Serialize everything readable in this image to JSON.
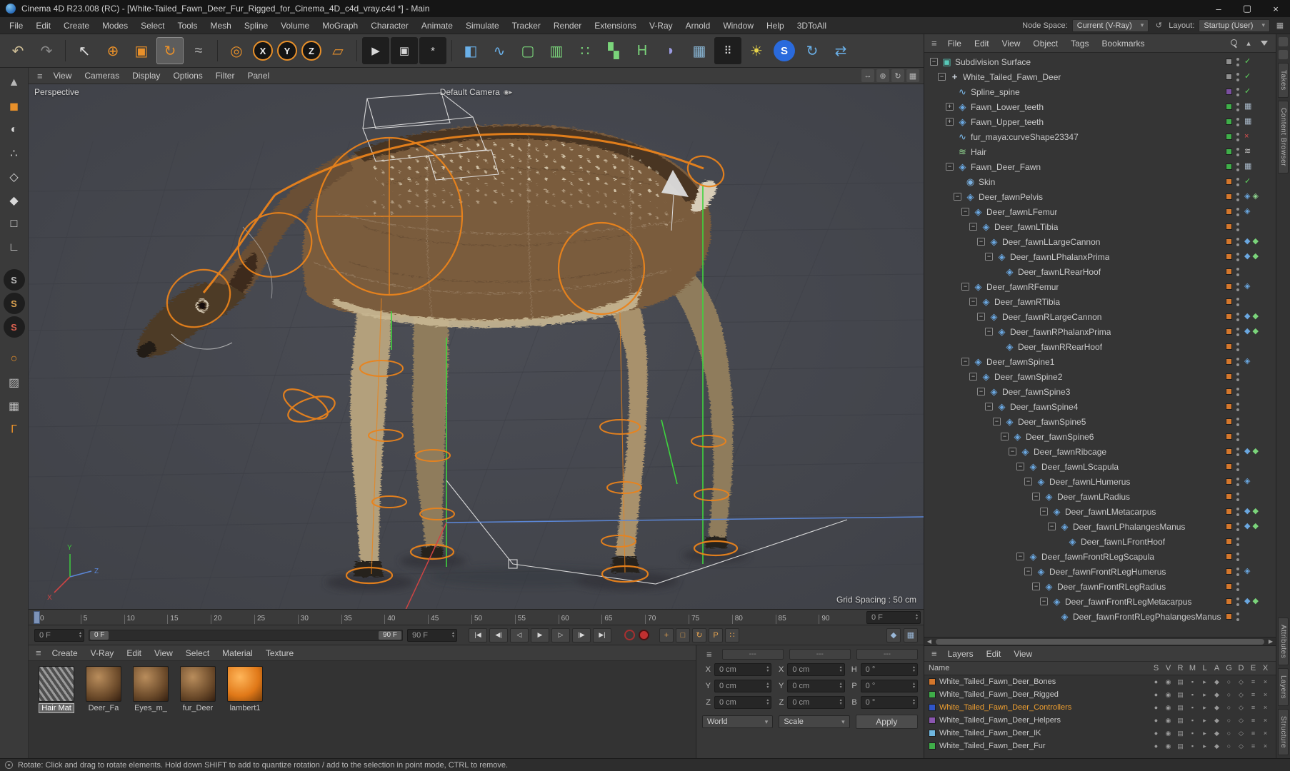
{
  "window": {
    "title": "Cinema 4D R23.008 (RC) - [White-Tailed_Fawn_Deer_Fur_Rigged_for_Cinema_4D_c4d_vray.c4d *] - Main"
  },
  "menubar": {
    "items": [
      "File",
      "Edit",
      "Create",
      "Modes",
      "Select",
      "Tools",
      "Mesh",
      "Spline",
      "Volume",
      "MoGraph",
      "Character",
      "Animate",
      "Simulate",
      "Tracker",
      "Render",
      "Extensions",
      "V-Ray",
      "Arnold",
      "Window",
      "Help",
      "3DToAll"
    ],
    "node_space_label": "Node Space:",
    "node_space_value": "Current (V-Ray)",
    "layout_label": "Layout:",
    "layout_value": "Startup (User)"
  },
  "toolbar": {
    "buttons": [
      {
        "name": "undo-button",
        "glyph": "↶",
        "c": "#cdbd96"
      },
      {
        "name": "redo-button",
        "glyph": "↷",
        "c": "#8a8a8a"
      },
      {
        "sep": true
      },
      {
        "name": "live-selection-button",
        "glyph": "↖",
        "c": "#e0e0e0"
      },
      {
        "name": "move-tool-button",
        "glyph": "⊕",
        "c": "#e8902a"
      },
      {
        "name": "scale-tool-button",
        "glyph": "▣",
        "c": "#e8902a"
      },
      {
        "name": "rotate-tool-button",
        "glyph": "↻",
        "c": "#e8902a",
        "active": true
      },
      {
        "name": "last-tool-button",
        "glyph": "≈",
        "c": "#b0b0b0"
      },
      {
        "sep": true
      },
      {
        "name": "coordinate-system-button",
        "glyph": "◎",
        "c": "#e8902a"
      },
      {
        "name": "x-axis-lock-button",
        "glyph": "X",
        "c": "#efefef",
        "ring": true
      },
      {
        "name": "y-axis-lock-button",
        "glyph": "Y",
        "c": "#efefef",
        "ring": true
      },
      {
        "name": "z-axis-lock-button",
        "glyph": "Z",
        "c": "#efefef",
        "ring": true
      },
      {
        "name": "workplane-button",
        "glyph": "▱",
        "c": "#e8902a"
      },
      {
        "sep": true
      },
      {
        "name": "render-view-button",
        "glyph": "▶",
        "c": "#d8d8d8",
        "bg": "#1e1e1e"
      },
      {
        "name": "render-picture-viewer-button",
        "glyph": "▣",
        "c": "#d8d8d8",
        "bg": "#1e1e1e"
      },
      {
        "name": "render-settings-button",
        "glyph": "*",
        "c": "#d8d8d8",
        "bg": "#1e1e1e"
      },
      {
        "sep": true
      },
      {
        "name": "add-cube-button",
        "glyph": "◧",
        "c": "#6ab0e8"
      },
      {
        "name": "pen-tool-button",
        "glyph": "∿",
        "c": "#6ab0e8"
      },
      {
        "name": "subdivision-surface-button",
        "glyph": "▢",
        "c": "#7ad47a"
      },
      {
        "name": "symmetry-button",
        "glyph": "▥",
        "c": "#7ad47a"
      },
      {
        "name": "cloner-button",
        "glyph": "∷",
        "c": "#7ad47a"
      },
      {
        "name": "fracture-button",
        "glyph": "▚",
        "c": "#7ad47a"
      },
      {
        "name": "field-force-button",
        "glyph": "H",
        "c": "#7ad47a"
      },
      {
        "name": "field-button",
        "glyph": "◗",
        "c": "#9a9ae0"
      },
      {
        "name": "array-button",
        "glyph": "▦",
        "c": "#8ab8d8"
      },
      {
        "name": "dots-button",
        "glyph": "⠿",
        "c": "#d8d8d8",
        "bg": "#1e1e1e"
      },
      {
        "name": "light-button",
        "glyph": "☀",
        "c": "#e8d44a"
      },
      {
        "name": "vray-logo-button",
        "glyph": "S",
        "c": "#ffffff",
        "bg": "#2a6adc",
        "round": true
      },
      {
        "name": "vray-render-button",
        "glyph": "↻",
        "c": "#6ab0e8"
      },
      {
        "name": "vray-frame-buffer-button",
        "glyph": "⇄",
        "c": "#6ab0e8"
      }
    ]
  },
  "left_toolbar": {
    "buttons": [
      {
        "name": "make-editable-button",
        "glyph": "▲",
        "c": "#b8b8b8"
      },
      {
        "name": "model-mode-button",
        "glyph": "◼",
        "c": "#e8902a"
      },
      {
        "name": "texture-mode-button",
        "glyph": "◐",
        "c": "#d8d8d8"
      },
      {
        "name": "points-mode-button",
        "glyph": "∴",
        "c": "#d8d8d8"
      },
      {
        "name": "edges-mode-button",
        "glyph": "◇",
        "c": "#d8d8d8"
      },
      {
        "name": "polygons-mode-button",
        "glyph": "◆",
        "c": "#d8d8d8"
      },
      {
        "name": "tweak-mode-button",
        "glyph": "□",
        "c": "#d8d8d8"
      },
      {
        "name": "workplane-mode-button",
        "glyph": "∟",
        "c": "#d8d8d8"
      },
      {
        "name": "viewport-solo-off-button",
        "glyph": "S",
        "c": "#b8b8b8",
        "round": true,
        "gap": true
      },
      {
        "name": "viewport-solo-single-button",
        "glyph": "S",
        "c": "#d8a050",
        "round": true
      },
      {
        "name": "viewport-solo-hierarchy-button",
        "glyph": "S",
        "c": "#d86050",
        "round": true
      },
      {
        "name": "enable-axis-button",
        "glyph": "○",
        "c": "#e8902a",
        "gap": true
      },
      {
        "name": "xray-button",
        "glyph": "▨",
        "c": "#b8b8b8"
      },
      {
        "name": "snap-button",
        "glyph": "▦",
        "c": "#b8b8b8"
      },
      {
        "name": "modeling-settings-button",
        "glyph": "Γ",
        "c": "#e8902a"
      }
    ]
  },
  "viewport": {
    "menus": [
      "View",
      "Cameras",
      "Display",
      "Options",
      "Filter",
      "Panel"
    ],
    "nav_icons": [
      "pan-view-icon",
      "zoom-view-icon",
      "rotate-view-icon",
      "toggle-views-icon"
    ],
    "view_label": "Perspective",
    "camera_label": "Default Camera",
    "grid_spacing": "Grid Spacing : 50 cm"
  },
  "timeline": {
    "ticks": [
      "0",
      "5",
      "10",
      "15",
      "20",
      "25",
      "30",
      "35",
      "40",
      "45",
      "50",
      "55",
      "60",
      "65",
      "70",
      "75",
      "80",
      "85",
      "90"
    ],
    "frame_field": "0 F"
  },
  "transport": {
    "current_frame": "0 F",
    "range_start_handle": "0 F",
    "range_end_handle": "90 F",
    "end_frame": "90 F",
    "play_buttons": [
      {
        "name": "goto-start-button",
        "glyph": "|◀"
      },
      {
        "name": "prev-key-button",
        "glyph": "◀|"
      },
      {
        "name": "prev-frame-button",
        "glyph": "◁"
      },
      {
        "name": "play-button",
        "glyph": "▶"
      },
      {
        "name": "next-frame-button",
        "glyph": "▷"
      },
      {
        "name": "next-key-button",
        "glyph": "|▶"
      },
      {
        "name": "goto-end-button",
        "glyph": "▶|"
      }
    ],
    "key_toggles": [
      {
        "name": "key-position-toggle",
        "glyph": "+"
      },
      {
        "name": "key-scale-toggle",
        "glyph": "□"
      },
      {
        "name": "key-rotation-toggle",
        "glyph": "↻"
      },
      {
        "name": "key-parameter-toggle",
        "glyph": "P"
      },
      {
        "name": "key-pla-toggle",
        "glyph": "∷"
      }
    ],
    "right_icons": [
      {
        "name": "keyframe-selection-icon",
        "glyph": "◆"
      },
      {
        "name": "heads-up-display-icon",
        "glyph": "▦"
      }
    ]
  },
  "materials": {
    "menus": [
      "Create",
      "V-Ray",
      "Edit",
      "View",
      "Select",
      "Material",
      "Texture"
    ],
    "items": [
      {
        "name": "Hair Mat",
        "kind": "hair",
        "selected": true
      },
      {
        "name": "Deer_Fa",
        "kind": "fur"
      },
      {
        "name": "Eyes_m_",
        "kind": "fur"
      },
      {
        "name": "fur_Deer",
        "kind": "fur"
      },
      {
        "name": "lambert1",
        "kind": "orange"
      }
    ]
  },
  "coordinates": {
    "headers": [
      "---",
      "---",
      "---"
    ],
    "rows": [
      {
        "l1": "X",
        "v1": "0 cm",
        "l2": "X",
        "v2": "0 cm",
        "l3": "H",
        "v3": "0 °"
      },
      {
        "l1": "Y",
        "v1": "0 cm",
        "l2": "Y",
        "v2": "0 cm",
        "l3": "P",
        "v3": "0 °"
      },
      {
        "l1": "Z",
        "v1": "0 cm",
        "l2": "Z",
        "v2": "0 cm",
        "l3": "B",
        "v3": "0 °"
      }
    ],
    "world": "World",
    "scale": "Scale",
    "apply": "Apply"
  },
  "object_manager": {
    "menus": [
      "File",
      "Edit",
      "View",
      "Object",
      "Tags",
      "Bookmarks"
    ],
    "icons": [
      "search-icon",
      "chevron-up-icon",
      "filter-icon"
    ],
    "tree": [
      {
        "label": "Subdivision Surface",
        "indent": 0,
        "type": "sds",
        "tog": "minus",
        "sq": "#8f8f8f",
        "tags": [
          "check"
        ]
      },
      {
        "label": "White_Tailed_Fawn_Deer",
        "indent": 1,
        "type": "null",
        "tog": "minus",
        "sq": "#8f8f8f",
        "tags": [
          "check"
        ]
      },
      {
        "label": "Spline_spine",
        "indent": 2,
        "type": "spline",
        "tog": "none",
        "sq": "#7b4fa0",
        "tags": [
          "check"
        ]
      },
      {
        "label": "Fawn_Lower_teeth",
        "indent": 2,
        "type": "joint",
        "tog": "plus",
        "sq": "#3fae49",
        "tags": [
          "weight"
        ]
      },
      {
        "label": "Fawn_Upper_teeth",
        "indent": 2,
        "type": "joint",
        "tog": "plus",
        "sq": "#3fae49",
        "tags": [
          "weight"
        ]
      },
      {
        "label": "fur_maya:curveShape23347",
        "indent": 2,
        "type": "spline",
        "tog": "none",
        "sq": "#3fae49",
        "tags": [
          "cross"
        ]
      },
      {
        "label": "Hair",
        "indent": 2,
        "type": "hair",
        "tog": "none",
        "sq": "#3fae49",
        "tags": [
          "hairtag"
        ]
      },
      {
        "label": "Fawn_Deer_Fawn",
        "indent": 2,
        "type": "joint",
        "tog": "minus",
        "sq": "#3fae49",
        "tags": [
          "weight"
        ]
      },
      {
        "label": "Skin",
        "indent": 3,
        "type": "skin",
        "tog": "none",
        "sq": "#d4772c",
        "tags": [
          "check"
        ]
      },
      {
        "label": "Deer_fawnPelvis",
        "indent": 3,
        "type": "joint",
        "tog": "minus",
        "sq": "#d4772c",
        "tags": [
          "joint",
          "joint2"
        ]
      },
      {
        "label": "Deer_fawnLFemur",
        "indent": 4,
        "type": "joint",
        "tog": "minus",
        "sq": "#d4772c",
        "tags": [
          "joint"
        ]
      },
      {
        "label": "Deer_fawnLTibia",
        "indent": 5,
        "type": "joint",
        "tog": "minus",
        "sq": "#d4772c",
        "tags": []
      },
      {
        "label": "Deer_fawnLLargeCannon",
        "indent": 6,
        "type": "joint",
        "tog": "minus",
        "sq": "#d4772c",
        "tags": [
          "ika",
          "ikb"
        ]
      },
      {
        "label": "Deer_fawnLPhalanxPrima",
        "indent": 7,
        "type": "joint",
        "tog": "minus",
        "sq": "#d4772c",
        "tags": [
          "ika",
          "ikb"
        ]
      },
      {
        "label": "Deer_fawnLRearHoof",
        "indent": 8,
        "type": "joint",
        "tog": "none",
        "sq": "#d4772c",
        "tags": []
      },
      {
        "label": "Deer_fawnRFemur",
        "indent": 4,
        "type": "joint",
        "tog": "minus",
        "sq": "#d4772c",
        "tags": [
          "joint"
        ]
      },
      {
        "label": "Deer_fawnRTibia",
        "indent": 5,
        "type": "joint",
        "tog": "minus",
        "sq": "#d4772c",
        "tags": []
      },
      {
        "label": "Deer_fawnRLargeCannon",
        "indent": 6,
        "type": "joint",
        "tog": "minus",
        "sq": "#d4772c",
        "tags": [
          "ika",
          "ikb"
        ]
      },
      {
        "label": "Deer_fawnRPhalanxPrima",
        "indent": 7,
        "type": "joint",
        "tog": "minus",
        "sq": "#d4772c",
        "tags": [
          "ika",
          "ikb"
        ]
      },
      {
        "label": "Deer_fawnRRearHoof",
        "indent": 8,
        "type": "joint",
        "tog": "none",
        "sq": "#d4772c",
        "tags": []
      },
      {
        "label": "Deer_fawnSpine1",
        "indent": 4,
        "type": "joint",
        "tog": "minus",
        "sq": "#d4772c",
        "tags": [
          "joint"
        ]
      },
      {
        "label": "Deer_fawnSpine2",
        "indent": 5,
        "type": "joint",
        "tog": "minus",
        "sq": "#d4772c",
        "tags": []
      },
      {
        "label": "Deer_fawnSpine3",
        "indent": 6,
        "type": "joint",
        "tog": "minus",
        "sq": "#d4772c",
        "tags": []
      },
      {
        "label": "Deer_fawnSpine4",
        "indent": 7,
        "type": "joint",
        "tog": "minus",
        "sq": "#d4772c",
        "tags": []
      },
      {
        "label": "Deer_fawnSpine5",
        "indent": 8,
        "type": "joint",
        "tog": "minus",
        "sq": "#d4772c",
        "tags": []
      },
      {
        "label": "Deer_fawnSpine6",
        "indent": 9,
        "type": "joint",
        "tog": "minus",
        "sq": "#d4772c",
        "tags": []
      },
      {
        "label": "Deer_fawnRibcage",
        "indent": 10,
        "type": "joint",
        "tog": "minus",
        "sq": "#d4772c",
        "tags": [
          "ika",
          "ikb"
        ]
      },
      {
        "label": "Deer_fawnLScapula",
        "indent": 11,
        "type": "joint",
        "tog": "minus",
        "sq": "#d4772c",
        "tags": []
      },
      {
        "label": "Deer_fawnLHumerus",
        "indent": 12,
        "type": "joint",
        "tog": "minus",
        "sq": "#d4772c",
        "tags": [
          "joint"
        ]
      },
      {
        "label": "Deer_fawnLRadius",
        "indent": 13,
        "type": "joint",
        "tog": "minus",
        "sq": "#d4772c",
        "tags": []
      },
      {
        "label": "Deer_fawnLMetacarpus",
        "indent": 14,
        "type": "joint",
        "tog": "minus",
        "sq": "#d4772c",
        "tags": [
          "ika",
          "ikb"
        ]
      },
      {
        "label": "Deer_fawnLPhalangesManus",
        "indent": 15,
        "type": "joint",
        "tog": "minus",
        "sq": "#d4772c",
        "tags": [
          "ika",
          "ikb"
        ]
      },
      {
        "label": "Deer_fawnLFrontHoof",
        "indent": 16,
        "type": "joint",
        "tog": "none",
        "sq": "#d4772c",
        "tags": []
      },
      {
        "label": "Deer_fawnFrontRLegScapula",
        "indent": 11,
        "type": "joint",
        "tog": "minus",
        "sq": "#d4772c",
        "tags": []
      },
      {
        "label": "Deer_fawnFrontRLegHumerus",
        "indent": 12,
        "type": "joint",
        "tog": "minus",
        "sq": "#d4772c",
        "tags": [
          "joint"
        ]
      },
      {
        "label": "Deer_fawnFrontRLegRadius",
        "indent": 13,
        "type": "joint",
        "tog": "minus",
        "sq": "#d4772c",
        "tags": []
      },
      {
        "label": "Deer_fawnFrontRLegMetacarpus",
        "indent": 14,
        "type": "joint",
        "tog": "minus",
        "sq": "#d4772c",
        "tags": [
          "ika",
          "ikb"
        ]
      },
      {
        "label": "Deer_fawnFrontRLegPhalangesManus",
        "indent": 15,
        "type": "joint",
        "tog": "none",
        "sq": "#d4772c",
        "tags": []
      }
    ]
  },
  "layers_panel": {
    "menus": [
      "Layers",
      "Edit",
      "View"
    ],
    "name_header": "Name",
    "columns": [
      "S",
      "V",
      "R",
      "M",
      "L",
      "A",
      "G",
      "D",
      "E",
      "X"
    ],
    "row_icons": [
      "solo",
      "visible",
      "render",
      "manager",
      "lock",
      "animation",
      "generators",
      "deformers",
      "expressions",
      "xref"
    ],
    "items": [
      {
        "name": "White_Tailed_Fawn_Deer_Bones",
        "color": "#d4772c"
      },
      {
        "name": "White_Tailed_Fawn_Deer_Rigged",
        "color": "#3fae49"
      },
      {
        "name": "White_Tailed_Fawn_Deer_Controllers",
        "color": "#2f55c8",
        "selected": true
      },
      {
        "name": "White_Tailed_Fawn_Deer_Helpers",
        "color": "#8a56b0"
      },
      {
        "name": "White_Tailed_Fawn_Deer_IK",
        "color": "#6fb7e0"
      },
      {
        "name": "White_Tailed_Fawn_Deer_Fur",
        "color": "#3fae49"
      }
    ]
  },
  "right_strip": {
    "top_tabs": [
      "Takes",
      "Content Browser"
    ],
    "bottom_tabs": [
      "Attributes",
      "Layers",
      "Structure"
    ]
  },
  "status_bar": {
    "text": "Rotate: Click and drag to rotate elements. Hold down SHIFT to add to quantize rotation / add to the selection in point mode, CTRL to remove."
  }
}
